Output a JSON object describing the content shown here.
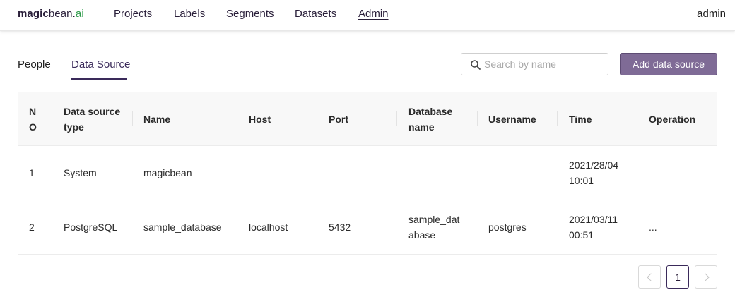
{
  "brand": {
    "bold": "magic",
    "regular": "bean.",
    "accent": "ai"
  },
  "nav": {
    "items": [
      {
        "label": "Projects"
      },
      {
        "label": "Labels"
      },
      {
        "label": "Segments"
      },
      {
        "label": "Datasets"
      },
      {
        "label": "Admin",
        "active": true
      }
    ]
  },
  "user": {
    "name": "admin"
  },
  "tabs": [
    {
      "label": "People"
    },
    {
      "label": "Data Source",
      "active": true
    }
  ],
  "search": {
    "placeholder": "Search by name",
    "value": ""
  },
  "add_button": {
    "label": "Add data source"
  },
  "table": {
    "columns": [
      "N\nO",
      "Data source\ntype",
      "Name",
      "Host",
      "Port",
      "Database\nname",
      "Username",
      "Time",
      "Operation"
    ],
    "rows": [
      {
        "no": "1",
        "type": "System",
        "name": "magicbean",
        "host": "",
        "port": "",
        "database": "",
        "username": "",
        "time": "2021/28/04\n10:01",
        "operation": ""
      },
      {
        "no": "2",
        "type": "PostgreSQL",
        "name": "sample_database",
        "host": "localhost",
        "port": "5432",
        "database": "sample_dat\nabase",
        "username": "postgres",
        "time": "2021/03/11\n00:51",
        "operation": "..."
      }
    ]
  },
  "pagination": {
    "current": "1"
  },
  "colors": {
    "accent": "#7f6b96",
    "brand_dark": "#2a1f3a",
    "brand_ai": "#2e9a4a",
    "tab_active": "#3a2a5a"
  }
}
